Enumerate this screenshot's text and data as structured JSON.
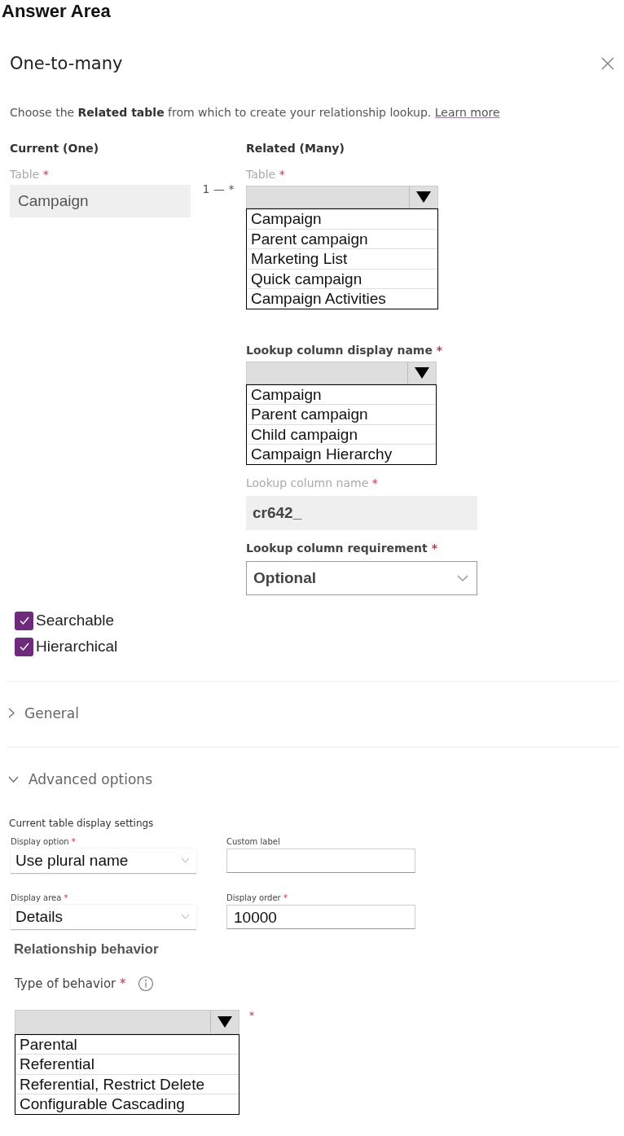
{
  "heading": "Answer Area",
  "panel": {
    "title": "One-to-many"
  },
  "intro": {
    "text": "Choose the **Related table** from which to create your relationship lookup.",
    "link": "Learn more"
  },
  "current": {
    "heading": "Current (One)",
    "table_label": "Table",
    "required": "*",
    "table_value": "Campaign"
  },
  "connector": "1 — *",
  "related": {
    "heading": "Related (Many)",
    "table_label": "Table",
    "required": "*",
    "table_options": [
      "Campaign",
      "Parent campaign",
      "Marketing List",
      "Quick campaign",
      "Campaign Activities"
    ],
    "display_name_label": "Lookup column display name",
    "display_name_options": [
      "Campaign",
      "Parent campaign",
      "Child campaign",
      "Campaign Hierarchy"
    ],
    "column_name_label": "Lookup column name",
    "column_name_value": "cr642_",
    "requirement_label": "Lookup column requirement",
    "requirement_value": "Optional"
  },
  "checkboxes": [
    {
      "label": "Searchable",
      "checked": true
    },
    {
      "label": "Hierarchical",
      "checked": true
    }
  ],
  "sections": [
    {
      "label": "General",
      "expanded": false
    },
    {
      "label": "Advanced options",
      "expanded": true
    }
  ],
  "advanced": {
    "subheading": "Current table display settings",
    "fields": [
      {
        "kind": "select",
        "label": "Display option",
        "required": "*",
        "value": "Use plural name"
      },
      {
        "kind": "input",
        "label": "Custom label"
      },
      {
        "kind": "select",
        "label": "Display area",
        "required": "*",
        "value": "Details"
      },
      {
        "kind": "input",
        "label": "Display order",
        "required": "*",
        "value": "10000"
      }
    ],
    "behavior_heading": "Relationship behavior",
    "behavior_label": "Type of behavior",
    "required": "*",
    "behavior_options": [
      "Parental",
      "Referential",
      "Referential, Restrict Delete",
      "Configurable Cascading"
    ],
    "behavior_side_mark": "*"
  }
}
